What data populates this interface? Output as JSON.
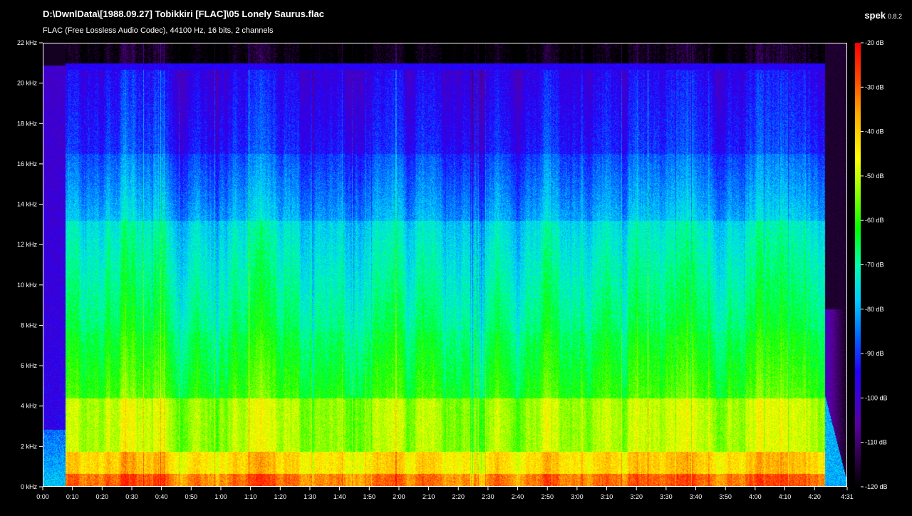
{
  "header": {
    "title": "D:\\DwnlData\\[1988.09.27] Tobikkiri [FLAC]\\05 Lonely Saurus.flac",
    "info": "FLAC (Free Lossless Audio Codec), 44100 Hz, 16 bits, 2 channels"
  },
  "app": {
    "name": "spek",
    "version": "0.8.2"
  },
  "frequency_axis": {
    "unit": "kHz",
    "ticks": [
      "0 kHz",
      "2 kHz",
      "4 kHz",
      "6 kHz",
      "8 kHz",
      "10 kHz",
      "12 kHz",
      "14 kHz",
      "16 kHz",
      "18 kHz",
      "20 kHz",
      "22 kHz"
    ],
    "max_khz": 22
  },
  "time_axis": {
    "ticks": [
      "0:00",
      "0:10",
      "0:20",
      "0:30",
      "0:40",
      "0:50",
      "1:00",
      "1:10",
      "1:20",
      "1:30",
      "1:40",
      "1:50",
      "2:00",
      "2:10",
      "2:20",
      "2:30",
      "2:40",
      "2:50",
      "3:00",
      "3:10",
      "3:20",
      "3:30",
      "3:40",
      "3:50",
      "4:00",
      "4:10",
      "4:20",
      "4:31"
    ],
    "duration_seconds": 271
  },
  "db_scale": {
    "ticks": [
      "-20 dB",
      "-30 dB",
      "-40 dB",
      "-50 dB",
      "-60 dB",
      "-70 dB",
      "-80 dB",
      "-90 dB",
      "-100 dB",
      "-110 dB",
      "-120 dB"
    ],
    "max_db": -20,
    "min_db": -120
  },
  "colors": {
    "background": "#000000",
    "frame": "#ffffff",
    "hot": "#ff0000",
    "cold": "#2200ff"
  }
}
